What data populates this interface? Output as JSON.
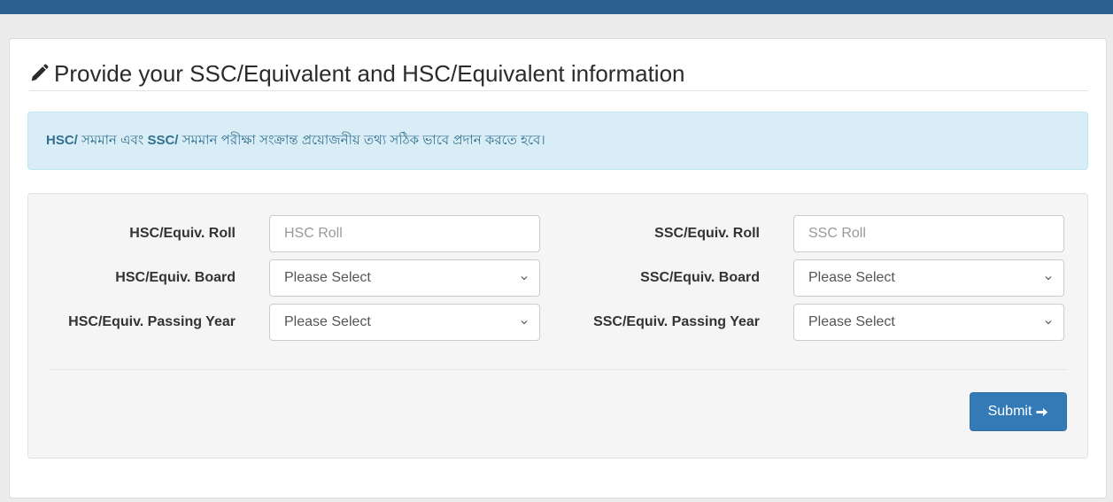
{
  "header": {
    "title": "Provide your SSC/Equivalent and HSC/Equivalent information",
    "icon": "pencil-icon"
  },
  "alert": {
    "part1_bold": "HSC/",
    "part2": " সমমান এবং ",
    "part3_bold": "SSC/",
    "part4": " সমমান পরীক্ষা সংক্রান্ত প্রয়োজনীয় তথ্য সঠিক ভাবে প্রদান করতে হবে।"
  },
  "form": {
    "hsc": {
      "roll_label": "HSC/Equiv. Roll",
      "roll_value": "",
      "roll_placeholder": "HSC Roll",
      "board_label": "HSC/Equiv. Board",
      "board_selected": "Please Select",
      "year_label": "HSC/Equiv. Passing Year",
      "year_selected": "Please Select"
    },
    "ssc": {
      "roll_label": "SSC/Equiv. Roll",
      "roll_value": "",
      "roll_placeholder": "SSC Roll",
      "board_label": "SSC/Equiv. Board",
      "board_selected": "Please Select",
      "year_label": "SSC/Equiv. Passing Year",
      "year_selected": "Please Select"
    },
    "submit_label": "Submit",
    "submit_icon": "arrow-right-icon"
  },
  "colors": {
    "topbar": "#2d5f92",
    "primary": "#337ab7",
    "alert_bg": "#d9edf7",
    "alert_text": "#31708f"
  }
}
